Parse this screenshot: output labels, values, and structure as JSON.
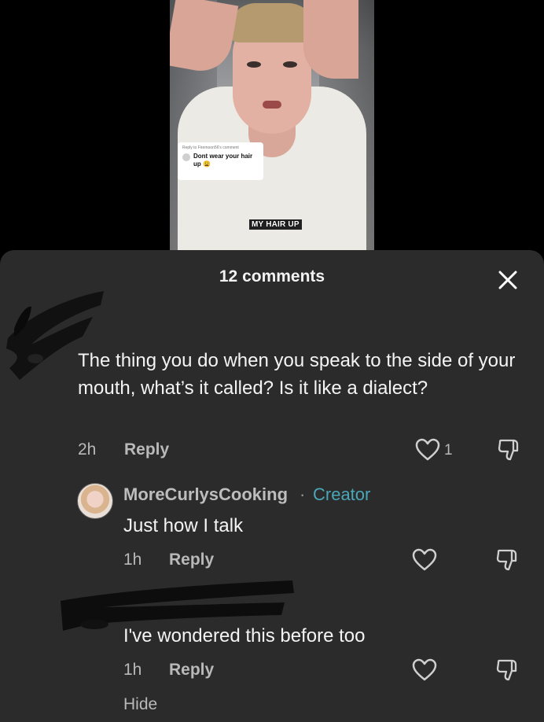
{
  "video": {
    "reply_card": {
      "heading": "Reply to Firemoon56's comment",
      "text": "Dont wear your hair up",
      "emoji": "😩"
    },
    "caption": "MY HAIR UP"
  },
  "sheet": {
    "title": "12 comments",
    "close_icon": "close-icon"
  },
  "comments": [
    {
      "author": "",
      "text": "The thing you do when you speak to the side of your mouth, what’s it called? Is it like a dialect?",
      "time": "2h",
      "reply_label": "Reply",
      "likes": "1"
    },
    {
      "author": "MoreCurlysCooking",
      "separator": "·",
      "badge": "Creator",
      "text": "Just how I talk",
      "time": "1h",
      "reply_label": "Reply"
    },
    {
      "author": "",
      "text": "I've wondered this before too",
      "time": "1h",
      "reply_label": "Reply"
    }
  ],
  "footer": {
    "hide_label": "Hide"
  },
  "colors": {
    "sheet_bg": "#2b2b2b",
    "creator": "#4aa7b8",
    "muted": "#b9b9b9"
  }
}
